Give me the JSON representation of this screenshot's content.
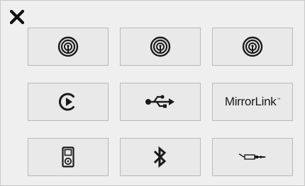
{
  "window": {
    "close_icon": "close-icon"
  },
  "sources": [
    {
      "id": "carplay-1",
      "icon": "carplay-icon"
    },
    {
      "id": "carplay-2",
      "icon": "carplay-icon"
    },
    {
      "id": "carplay-3",
      "icon": "carplay-icon"
    },
    {
      "id": "streaming",
      "icon": "streaming-play-icon"
    },
    {
      "id": "usb",
      "icon": "usb-icon"
    },
    {
      "id": "mirrorlink",
      "icon": "mirrorlink-logo",
      "label_prefix": "Mirr",
      "label_o": "o",
      "label_r": "r",
      "label_link": "Link",
      "label_tm": "™"
    },
    {
      "id": "ipod",
      "icon": "ipod-icon"
    },
    {
      "id": "bluetooth",
      "icon": "bluetooth-icon"
    },
    {
      "id": "aux",
      "icon": "aux-jack-icon"
    }
  ],
  "colors": {
    "icon": "#1a1a1a",
    "tile_border": "#b9b9b9",
    "tile_bg": "#e9e9e9",
    "panel_bg": "#efefef"
  }
}
